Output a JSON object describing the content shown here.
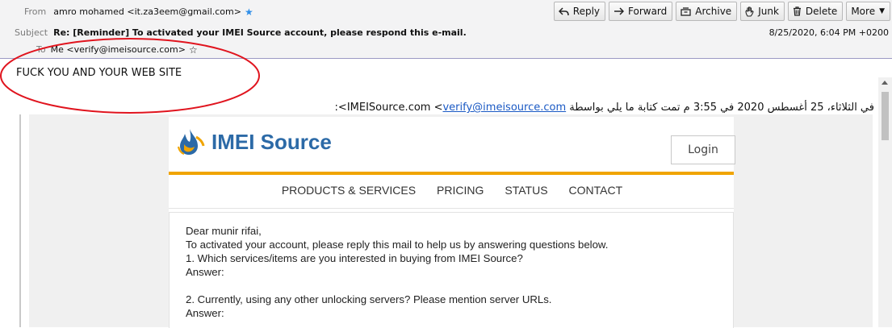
{
  "header": {
    "from_label": "From",
    "from_value": "amro mohamed <it.za3eem@gmail.com>",
    "subject_label": "Subject",
    "subject_value": "Re: [Reminder] To activated your IMEI Source account, please respond this e-mail.",
    "to_label": "To",
    "to_value": "Me <verify@imeisource.com>",
    "date": "8/25/2020, 6:04 PM +0200"
  },
  "toolbar": {
    "reply": "Reply",
    "forward": "Forward",
    "archive": "Archive",
    "junk": "Junk",
    "delete": "Delete",
    "more": "More"
  },
  "body": {
    "reply_text": "FUCK YOU AND YOUR WEB SITE",
    "quote_pre": "في الثلاثاء، 25 أغسطس 2020 في 3:55 م تمت كتابة ما يلي بواسطة IMEISource.com <",
    "quote_link": "verify@imeisource.com",
    "quote_post": ">:"
  },
  "card": {
    "logo_text": "IMEI Source",
    "login_label": "Login",
    "nav": [
      "PRODUCTS & SERVICES",
      "PRICING",
      "STATUS",
      "CONTACT"
    ],
    "letter_lines": [
      "Dear munir rifai,",
      "To activated your account, please reply this mail to help us by answering questions below.",
      "1. Which services/items are you interested in buying from IMEI Source?",
      "Answer:",
      "",
      "2. Currently, using any other unlocking servers? Please mention server URLs.",
      "Answer:"
    ]
  },
  "colors": {
    "accent_blue": "#2f8ee8",
    "link": "#1a59c4",
    "annotation_red": "#e0141e",
    "logo_blue": "#2c6aa7",
    "logo_orange": "#f0a400"
  }
}
